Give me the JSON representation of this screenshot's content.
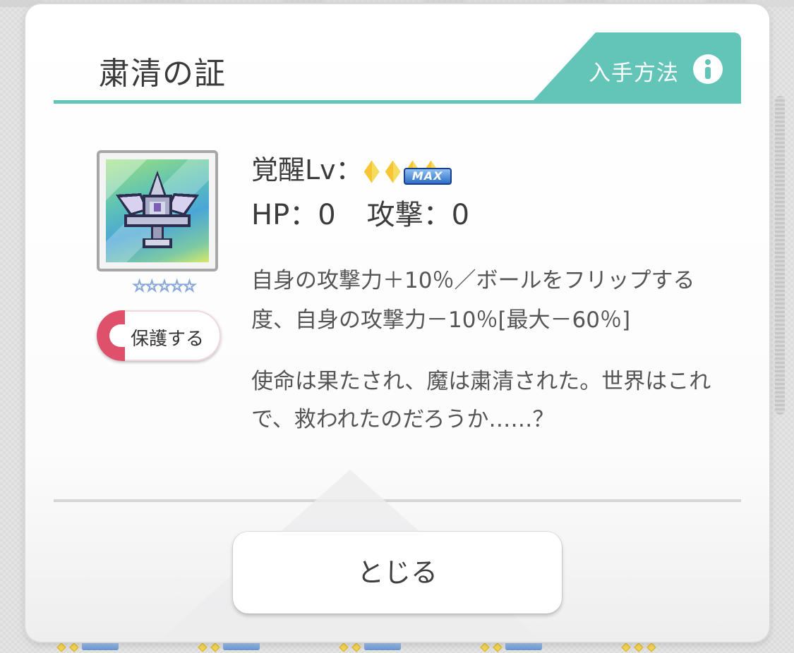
{
  "dialog": {
    "title": "粛清の証",
    "obtain_label": "入手方法",
    "obtain_icon": "info-icon",
    "accent_color": "#63c4b8"
  },
  "item": {
    "rarity_stars": "☆☆☆☆☆",
    "protect_label": "保護する",
    "protect_color": "#df506a",
    "awaken_label": "覚醒Lv：",
    "awaken_max": "MAX",
    "hp_label": "HP：0",
    "attack_label": "攻撃：0",
    "description": "自身の攻撃力＋10％／ボールをフリップする度、自身の攻撃力－10％[最大－60％]",
    "flavor": "使命は果たされ、魔は粛清された。世界はこれで、救われたのだろうか……？"
  },
  "footer": {
    "close_label": "とじる"
  }
}
